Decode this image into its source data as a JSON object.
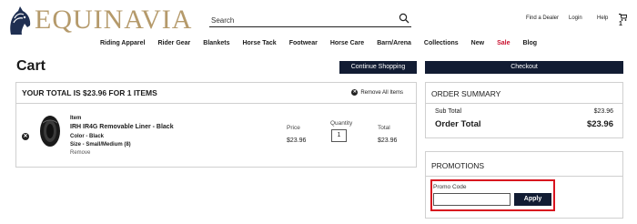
{
  "brand": {
    "name": "EQUINAVIA",
    "logo_icon": "horse-head-icon",
    "accent": "#b59a6b"
  },
  "search": {
    "placeholder": "Search",
    "icon": "search-icon"
  },
  "utility_links": {
    "find_dealer": "Find a Dealer",
    "login": "Login",
    "help": "Help",
    "cart_count": "1"
  },
  "nav": {
    "items": [
      "Riding Apparel",
      "Rider Gear",
      "Blankets",
      "Horse Tack",
      "Footwear",
      "Horse Care",
      "Barn/Arena",
      "Collections",
      "New",
      "Sale",
      "Blog"
    ],
    "sale_color": "#c8102e"
  },
  "page": {
    "title": "Cart",
    "continue_label": "Continue Shopping",
    "checkout_label": "Checkout",
    "button_color": "#121c33"
  },
  "cart": {
    "total_text": "YOUR TOTAL IS $23.96 FOR 1 ITEMS",
    "remove_all": "Remove All Items",
    "item": {
      "label": "Item",
      "name": "IRH IR4G Removable Liner - Black",
      "color": "Color - Black",
      "size": "Size - Small/Medium (8)",
      "remove": "Remove",
      "price_label": "Price",
      "price": "$23.96",
      "quantity_label": "Quantity",
      "quantity": "1",
      "total_label": "Total",
      "total": "$23.96"
    }
  },
  "summary": {
    "title": "ORDER SUMMARY",
    "subtotal_label": "Sub Total",
    "subtotal": "$23.96",
    "order_total_label": "Order Total",
    "order_total": "$23.96"
  },
  "promotions": {
    "title": "PROMOTIONS",
    "code_label": "Promo Code",
    "code_value": "",
    "apply_label": "Apply",
    "highlight_color": "#d8131e"
  }
}
